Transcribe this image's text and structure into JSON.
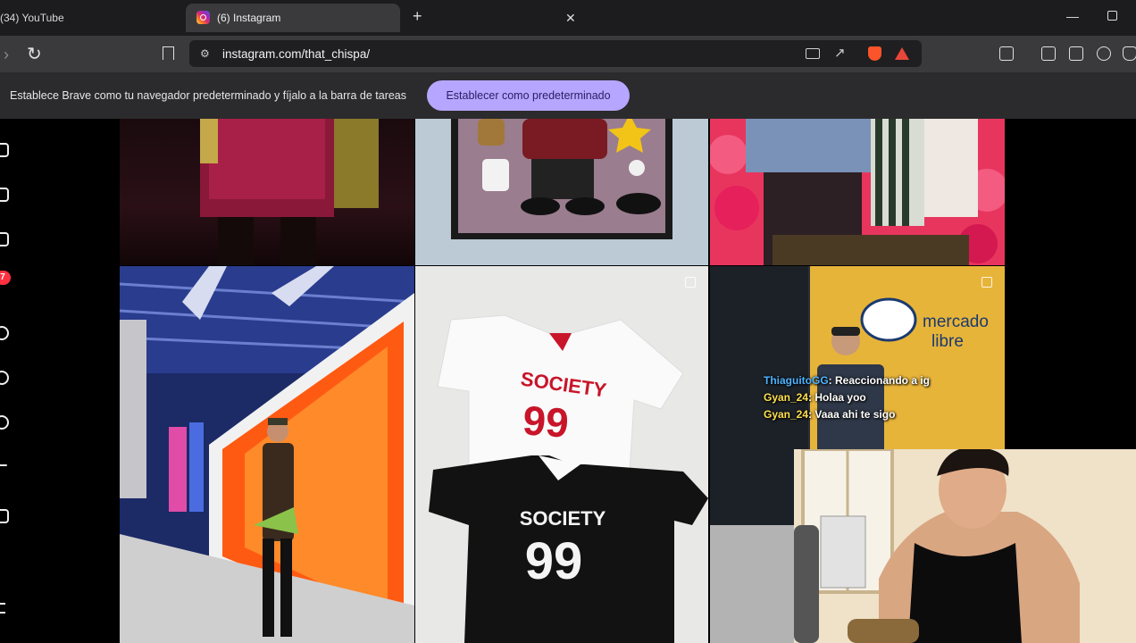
{
  "browser": {
    "tabs": [
      {
        "title": "(34) YouTube",
        "active": false
      },
      {
        "title": "(6) Instagram",
        "active": true
      }
    ],
    "close_tab_glyph": "✕",
    "new_tab_glyph": "+",
    "url": "instagram.com/that_chispa/",
    "window_controls": [
      "minimize",
      "restore"
    ]
  },
  "infobar": {
    "message": "Establece Brave como tu navegador predeterminado y fíjalo a la barra de tareas",
    "button_label": "Establecer como predeterminado"
  },
  "sidebar": {
    "notification_count": "7"
  },
  "posts": [
    {
      "id": "post-1",
      "shirt_text": "",
      "multi": false
    },
    {
      "id": "post-2",
      "multi": false
    },
    {
      "id": "post-3",
      "multi": false
    },
    {
      "id": "post-4",
      "multi": true
    },
    {
      "id": "post-5",
      "multi": true,
      "shirt_top": "SOCIETY",
      "number_top": "99",
      "shirt_bottom": "SOCIETY",
      "number_bottom": "99"
    },
    {
      "id": "post-6",
      "multi": true,
      "sign_line1": "mercado",
      "sign_line2": "libre"
    }
  ],
  "stream_chat": [
    {
      "user": "ThiaguitoGG",
      "text": ": Reaccionando a ig"
    },
    {
      "user": "Gyan_24",
      "text": ": Holaa yoo"
    },
    {
      "user": "Gyan_24",
      "text": ": Vaaa ahi te sigo"
    }
  ],
  "colors": {
    "accent_button": "#b7a6ff",
    "badge": "#ff3040"
  }
}
